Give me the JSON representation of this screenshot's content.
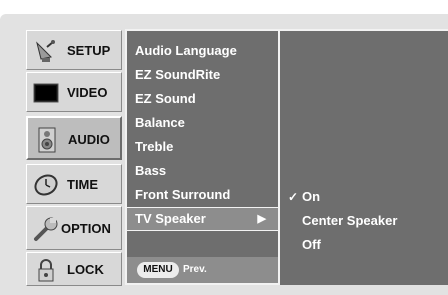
{
  "sidebar": {
    "items": [
      {
        "label": "SETUP",
        "icon": "satellite-dish-icon"
      },
      {
        "label": "VIDEO",
        "icon": "tv-screen-icon"
      },
      {
        "label": "AUDIO",
        "icon": "speaker-icon",
        "active": true
      },
      {
        "label": "TIME",
        "icon": "clock-icon"
      },
      {
        "label": "OPTION",
        "icon": "wrench-icon"
      },
      {
        "label": "LOCK",
        "icon": "padlock-icon"
      }
    ]
  },
  "audio_menu": {
    "items": [
      "Audio Language",
      "EZ SoundRite",
      "EZ Sound",
      "Balance",
      "Treble",
      "Bass",
      "Front Surround",
      "TV Speaker"
    ],
    "selected": "TV Speaker",
    "arrow": "▶"
  },
  "footer": {
    "menu_key": "MENU",
    "hint": "Prev."
  },
  "submenu": {
    "checkmark": "✓",
    "options": [
      "On",
      "Center Speaker",
      "Off"
    ],
    "selected": "On"
  },
  "colors": {
    "panel": "#6e6e6e",
    "highlight": "#8d8d8d",
    "frame": "#e2e2e2",
    "sidebar_button": "#d8d8d8"
  }
}
